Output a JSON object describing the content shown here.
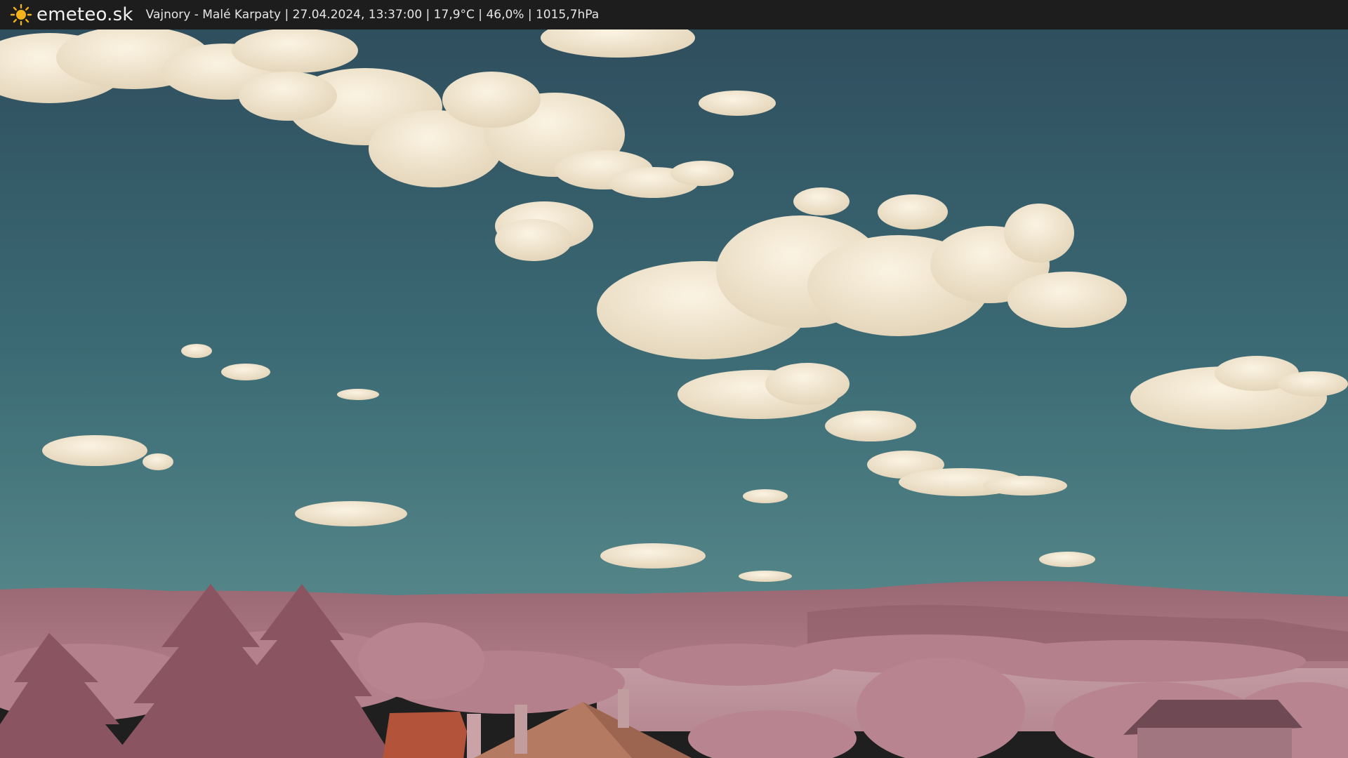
{
  "header": {
    "brand": "emeteo.sk",
    "brand_icon": "sun-icon",
    "caption": "Vajnory - Malé Karpaty | 27.04.2024, 13:37:00 | 17,9°C | 46,0% | 1015,7hPa"
  },
  "colors": {
    "bar": "#1d1d1d",
    "sun": "#f3b21a",
    "sky_top": "#2f4f5f",
    "sky_bottom": "#4f8285",
    "cloud": "#f1e6cf",
    "hills": "#a8717c",
    "vegetation": "#b98590",
    "roof": "#b2533a"
  }
}
